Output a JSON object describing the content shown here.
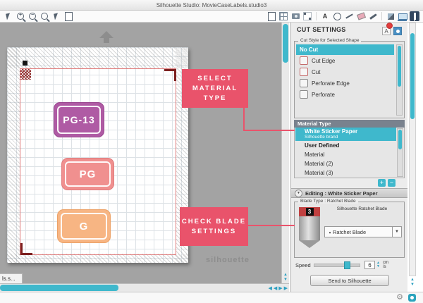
{
  "window": {
    "title": "Silhouette Studio: MovieCaseLabels.studio3"
  },
  "toolbar": {
    "left_icon_names": [
      "zoom-cursor",
      "zoom-in",
      "zoom-out",
      "drag-zoom",
      "select-tool",
      "fit-to-page"
    ],
    "right_icon_names": [
      "open-page",
      "grid-options",
      "pixscan",
      "registration-marks",
      "text-tool",
      "draw-ellipse",
      "draw-line",
      "eraser",
      "knife",
      "fill-color",
      "send-to-silhouette",
      "cut-settings"
    ]
  },
  "icons": {
    "plus": "+",
    "minus": "−",
    "letter_a": "A",
    "gear": "⚙",
    "down": "▼",
    "up": "▲",
    "left": "◀",
    "right": "▶"
  },
  "canvas": {
    "watermark": "silhouette",
    "labels": [
      {
        "text": "PG-13",
        "fill": "#af5ba4",
        "border": "#99458f"
      },
      {
        "text": "PG",
        "fill": "#f0908f",
        "border": "#df7b7d"
      },
      {
        "text": "G",
        "fill": "#f7b583",
        "border": "#eca267"
      }
    ]
  },
  "callouts": [
    {
      "text": "SELECT MATERIAL TYPE"
    },
    {
      "text": "CHECK BLADE SETTINGS"
    }
  ],
  "panel": {
    "title": "CUT SETTINGS",
    "cut_style": {
      "legend": "Cut Style for Selected Shape",
      "options": [
        "No Cut",
        "Cut Edge",
        "Cut",
        "Perforate Edge",
        "Perforate"
      ]
    },
    "material": {
      "header": "Material Type",
      "selected_name": "White Sticker Paper",
      "selected_sub": "Silhouette brand",
      "options": [
        "User Defined",
        "Material",
        "Material (2)",
        "Material (3)"
      ]
    },
    "editing_bar": "Editing : White Sticker Paper",
    "blade": {
      "legend": "Blade Type : Ratchet Blade",
      "product": "Silhouette Ratchet Blade",
      "number": "3",
      "dropdown_value": "Ratchet Blade"
    },
    "speed": {
      "label": "Speed",
      "value": "6",
      "unit_top": "cm",
      "unit_bottom": "/s"
    },
    "send_button": "Send to Silhouette"
  },
  "tabs": {
    "document": "ls.s..."
  },
  "colors": {
    "accent_teal": "#3fb8cc",
    "callout_red": "#e9536b"
  }
}
